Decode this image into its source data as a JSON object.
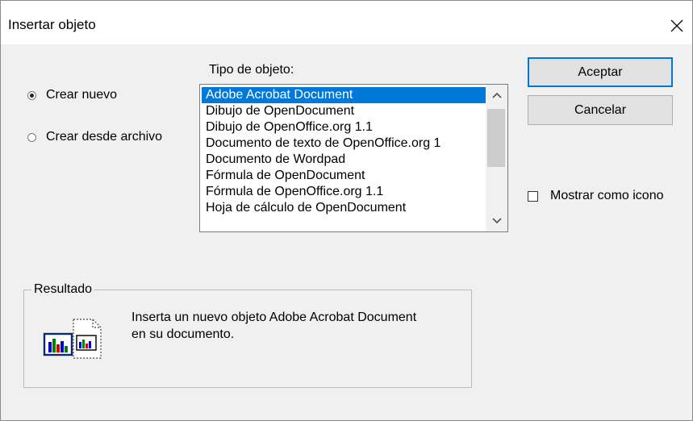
{
  "dialog": {
    "title": "Insertar objeto",
    "close_icon": "close-icon"
  },
  "options": {
    "create_new_label": "Crear nuevo",
    "create_new_checked": true,
    "create_from_file_label": "Crear desde archivo",
    "create_from_file_checked": false
  },
  "object_type": {
    "label": "Tipo de objeto:",
    "items": [
      "Adobe Acrobat Document",
      "Dibujo de OpenDocument",
      "Dibujo de OpenOffice.org 1.1",
      "Documento de texto de OpenOffice.org 1",
      "Documento de Wordpad",
      "Fórmula de OpenDocument",
      "Fórmula de OpenOffice.org 1.1",
      "Hoja de cálculo de OpenDocument"
    ],
    "selected_index": 0
  },
  "buttons": {
    "ok_label": "Aceptar",
    "cancel_label": "Cancelar"
  },
  "show_as_icon": {
    "label": "Mostrar como icono",
    "checked": false
  },
  "result": {
    "legend": "Resultado",
    "text": "Inserta un nuevo objeto Adobe Acrobat Document en su documento.",
    "icon": "insert-object-icon"
  },
  "colors": {
    "selection": "#0078d7",
    "dialog_bg": "#f0f0f0",
    "button_bg": "#e1e1e1",
    "default_button_border": "#0078d7"
  }
}
